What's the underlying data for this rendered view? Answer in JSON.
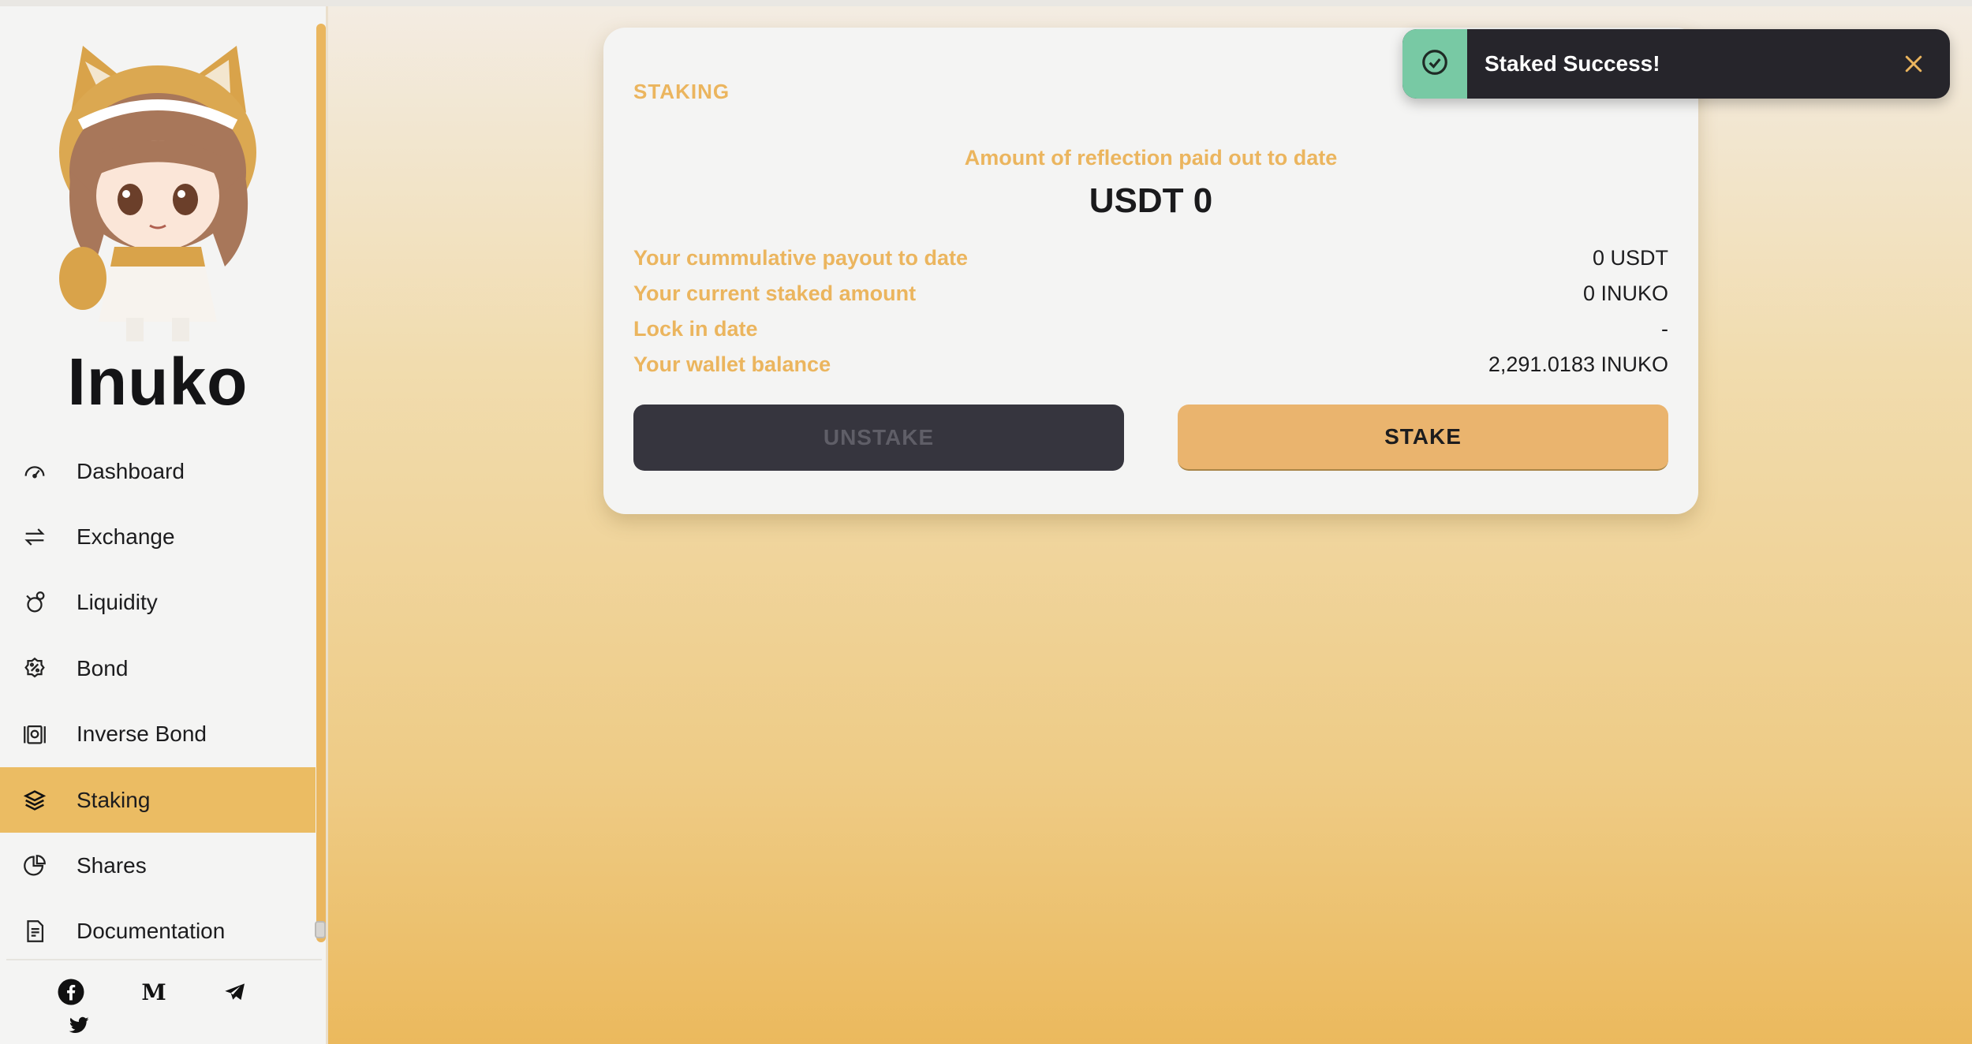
{
  "sidebar": {
    "brand": "Inuko",
    "items": [
      {
        "label": "Dashboard",
        "icon": "speedometer-icon"
      },
      {
        "label": "Exchange",
        "icon": "swap-arrows-icon"
      },
      {
        "label": "Liquidity",
        "icon": "coins-hand-icon"
      },
      {
        "label": "Bond",
        "icon": "percent-badge-icon"
      },
      {
        "label": "Inverse Bond",
        "icon": "inverse-bond-icon"
      },
      {
        "label": "Staking",
        "icon": "layers-icon",
        "active": true
      },
      {
        "label": "Shares",
        "icon": "pie-chart-icon"
      },
      {
        "label": "Documentation",
        "icon": "document-icon"
      }
    ],
    "social": [
      "facebook-icon",
      "medium-icon",
      "telegram-icon",
      "twitter-icon"
    ]
  },
  "staking": {
    "title": "STAKING",
    "reflection_label": "Amount of reflection paid out to date",
    "reflection_value": "USDT 0",
    "rows": [
      {
        "label": "Your cummulative payout to date",
        "value": "0 USDT"
      },
      {
        "label": "Your current staked amount",
        "value": "0 INUKO"
      },
      {
        "label": "Lock in date",
        "value": "-"
      },
      {
        "label": "Your wallet balance",
        "value": "2,291.0183 INUKO"
      }
    ],
    "unstake_label": "UNSTAKE",
    "stake_label": "STAKE"
  },
  "toast": {
    "message": "Staked Success!",
    "status": "success",
    "icon": "check-circle-icon",
    "close_icon": "close-icon"
  },
  "colors": {
    "accent": "#ebb55e",
    "active_nav": "#ebbc63",
    "toast_bg": "#26252b",
    "toast_success": "#78c9a4",
    "unstake_bg": "#36353e",
    "stake_bg": "#eab46e"
  }
}
